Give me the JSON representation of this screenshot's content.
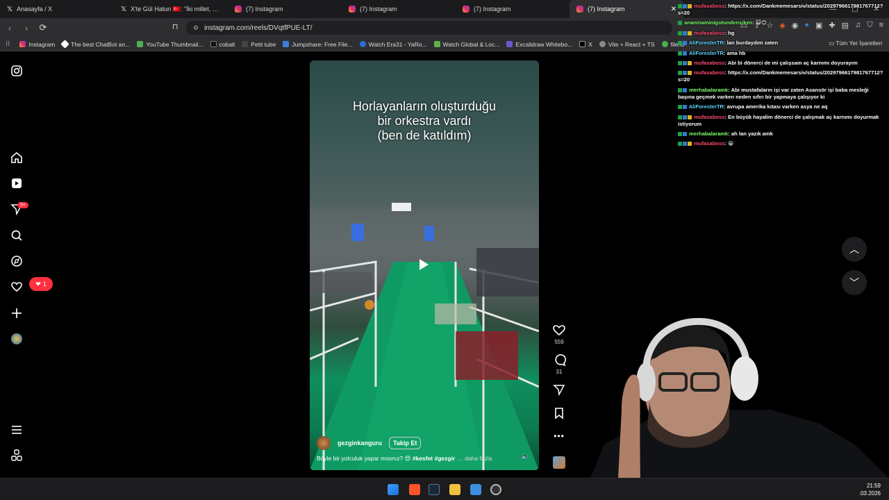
{
  "tabs": [
    {
      "title": "Anasayfa / X",
      "icon": "x"
    },
    {
      "title": "X'te Gül Hatun 🇹🇷: \"İki millet, sıfır dev",
      "icon": "x"
    },
    {
      "title": "(7) Instagram",
      "icon": "ig"
    },
    {
      "title": "(7) Instagram",
      "icon": "ig"
    },
    {
      "title": "(7) Instagram",
      "icon": "ig"
    },
    {
      "title": "(7) Instagram",
      "icon": "ig",
      "active": true
    }
  ],
  "address": {
    "url": "instagram.com/reels/DVqtfPUE-LT/"
  },
  "bookmarks": [
    {
      "label": "Instagram",
      "color": "#e02d6e"
    },
    {
      "label": "The best ChatBot an...",
      "color": "#ffffff"
    },
    {
      "label": "YouTube Thumbnail...",
      "color": "#4caf50"
    },
    {
      "label": "cobalt",
      "color": "#222222"
    },
    {
      "label": "Petit tube",
      "color": "#333333"
    },
    {
      "label": "Jumpshare: Free File...",
      "color": "#3d7dd8"
    },
    {
      "label": "Watch Era31 - YaRo...",
      "color": "#2a6fd4"
    },
    {
      "label": "Watch Global & Loc...",
      "color": "#5fb04b"
    },
    {
      "label": "Excalidraw Whitebo...",
      "color": "#6a5acd"
    },
    {
      "label": "X",
      "color": "#000000"
    },
    {
      "label": "Vite + React + TS",
      "color": "#8a8a8a"
    },
    {
      "label": "file.io",
      "color": "#4caf50"
    }
  ],
  "bookmarks_all": "Tüm Yer İşaretleri",
  "ig_nav": {
    "explore_badge": "9+",
    "notifications_count": "1"
  },
  "reel": {
    "caption": [
      "Horlayanların oluşturduğu",
      "bir orkestra vardı",
      "(ben de katıldım)"
    ],
    "username": "gezginkanguru",
    "follow_label": "Takip Et",
    "description": "Böyle bir yolculuk yapar mısınız? 😍",
    "tags": "#kesfet #gezgir",
    "more": "... daha fazla",
    "likes": "559",
    "comments": "31"
  },
  "chat": [
    {
      "user": "mufasaboss",
      "color": "#ff4b6e",
      "text": ": https://x.com/Dankmemesarsiv/status/2029796617981767712?s=20"
    },
    {
      "user": "ananinaminigotundensiken",
      "color": "#7dff6a",
      "text": ": 😺😊"
    },
    {
      "user": "mufasaboss",
      "color": "#ff4b6e",
      "text": ": hg"
    },
    {
      "user": "AliForesterTR",
      "color": "#5ad6ff",
      "text": ": lan burdaydım zaten"
    },
    {
      "user": "AliForesterTR",
      "color": "#5ad6ff",
      "text": ": ama hb"
    },
    {
      "user": "mufasaboss",
      "color": "#ff4b6e",
      "text": ": Abi bi dönerci de mi çalışsam aç karnımı doyurayım"
    },
    {
      "user": "mufasaboss",
      "color": "#ff4b6e",
      "text": ": https://x.com/Dankmemesarsiv/status/2029796617981767712?s=20"
    },
    {
      "user": "merhabalaramk",
      "color": "#7dff6a",
      "text": ": Abi mustafaların işi var zaten Asansör işi baba mesleği başına geçmek varken neden sıfırı bir yapmaya çalışıyor ki"
    },
    {
      "user": "AliForesterTR",
      "color": "#5ad6ff",
      "text": ": avrupa amerika kıtası varken asya ne aq"
    },
    {
      "user": "mufasaboss",
      "color": "#ff4b6e",
      "text": ": En büyük hayalim dönerci de çalışmak aç karnımı doyurmak istiyorum"
    },
    {
      "user": "merhabalaramk",
      "color": "#7dff6a",
      "text": ": ah lan yazık amk"
    },
    {
      "user": "mufasaboss",
      "color": "#ff4b6e",
      "text": ": 😀"
    }
  ],
  "clock": {
    "time": "21:59",
    "date": ".03.2026"
  },
  "colors": {
    "accent": "#ff3040",
    "floor": "#0f8f5e"
  }
}
